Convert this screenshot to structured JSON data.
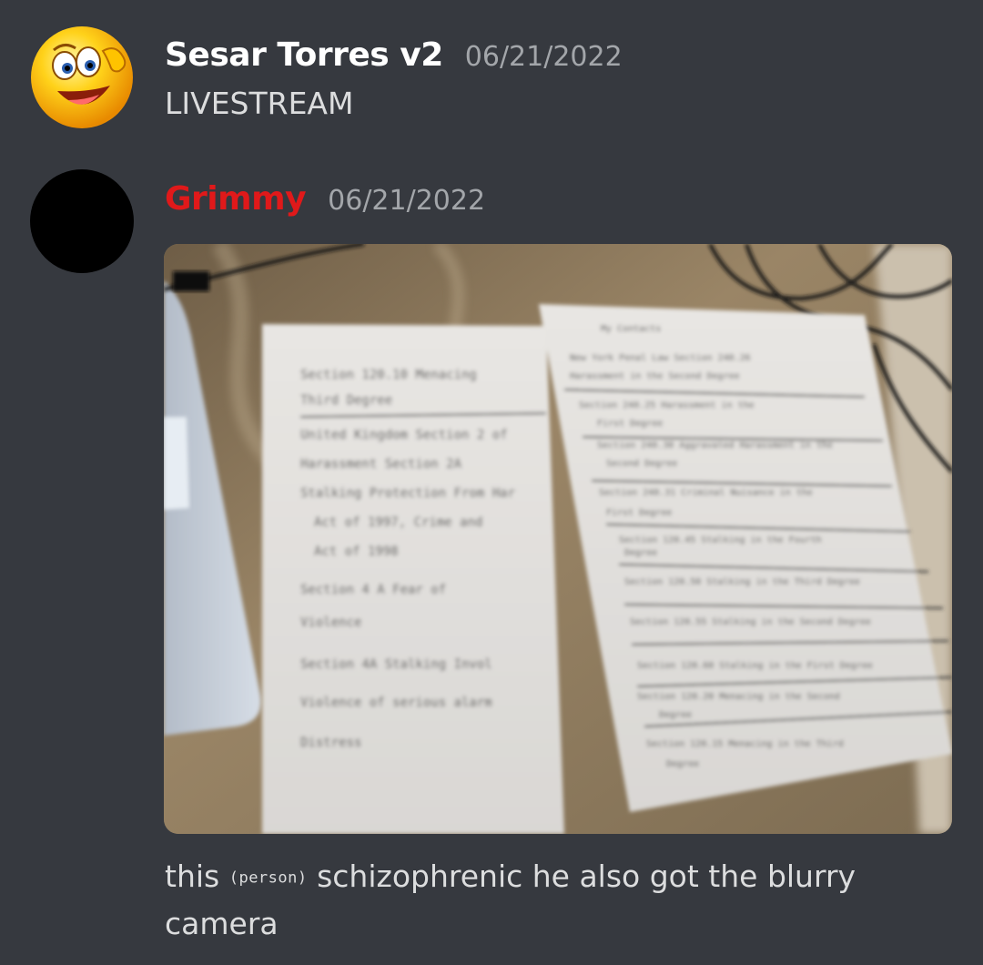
{
  "messages": [
    {
      "username": "Sesar Torres v2",
      "timestamp": "06/21/2022",
      "text": "LIVESTREAM",
      "name_color": "#ffffff",
      "avatar_icon": "smiley-face-avatar"
    },
    {
      "username": "Grimmy",
      "timestamp": "06/21/2022",
      "name_color": "#e0191a",
      "avatar_icon": "black-circle-avatar",
      "attachment": {
        "type": "image",
        "subject": "handwritten-notes-photo",
        "left_page_lines": [
          "Section 120.10 Menacing",
          "Third Degree",
          "United Kingdom Section 2 of",
          "Harassment Section 2A",
          "Stalking Protection From Har",
          "Act of 1997, Crime and",
          "Act of 1998",
          "Section 4 A Fear of",
          "Violence",
          "Section 4A Stalking Invol",
          "Violence of serious alarm",
          "Distress"
        ],
        "right_page_lines": [
          "My Contacts",
          "New York Penal Law Section 240.26",
          "Harassment in the Second Degree",
          "Section 240.25 Harassment in the",
          "First Degree",
          "Section 240.30 Aggravated Harassment in the",
          "Second Degree",
          "Section 240.31 Criminal Nuisance in the",
          "First Degree",
          "Section 120.45 Stalking in the Fourth",
          "Degree",
          "Section 120.50 Stalking in the Third Degree",
          "Section 120.55 Stalking in the Second Degree",
          "Section 120.60 Stalking in the First Degree",
          "Section 120.20 Menacing in the Second",
          "Degree",
          "Section 120.15 Menacing in the Third",
          "Degree"
        ]
      },
      "text_parts": {
        "before": "this ",
        "tag": "(person)",
        "after": " schizophrenic he also got the  blurry camera"
      }
    }
  ]
}
